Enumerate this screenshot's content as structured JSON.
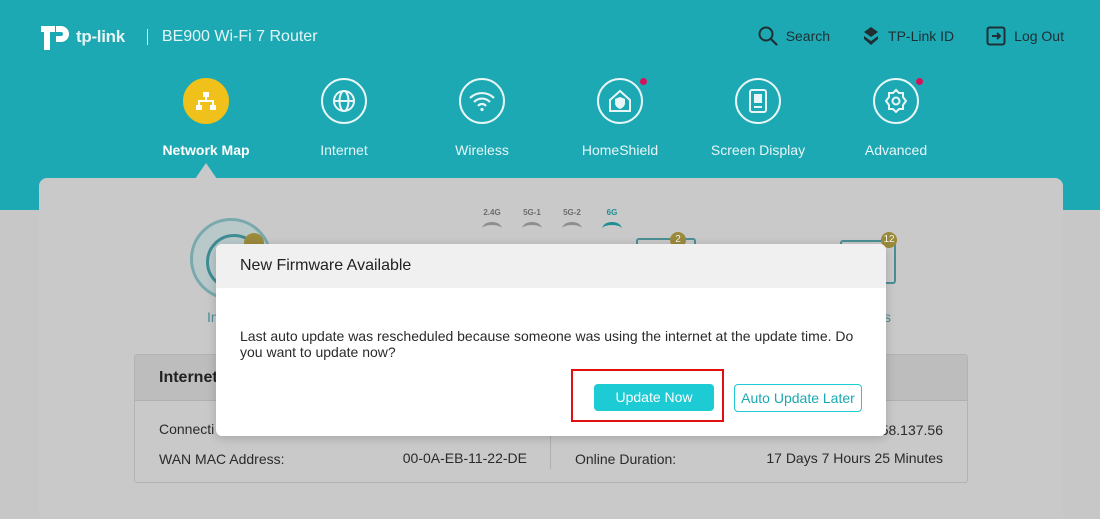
{
  "header": {
    "brand": "tp-link",
    "model": "BE900 Wi-Fi 7 Router",
    "links": {
      "search": "Search",
      "tplink_id": "TP-Link ID",
      "logout": "Log Out"
    }
  },
  "nav": {
    "items": [
      {
        "label": "Network Map",
        "icon": "network-map-icon",
        "active": true
      },
      {
        "label": "Internet",
        "icon": "globe-icon"
      },
      {
        "label": "Wireless",
        "icon": "wifi-icon"
      },
      {
        "label": "HomeShield",
        "icon": "home-shield-icon",
        "notify": true
      },
      {
        "label": "Screen Display",
        "icon": "screen-display-icon"
      },
      {
        "label": "Advanced",
        "icon": "gear-icon",
        "notify": true
      }
    ]
  },
  "background": {
    "bands": [
      "2.4G",
      "5G-1",
      "5G-2",
      "6G"
    ],
    "active_band": "6G",
    "badge_clients_a": "2",
    "badge_clients_b": "12",
    "internet_label_fragment": "In",
    "clients_label_fragment": "s",
    "internet_card": {
      "title": "Internet",
      "connection_label_fragment": "Connecti",
      "wan_mac_label": "WAN MAC Address:",
      "wan_mac_value": "00-0A-EB-11-22-DE",
      "ip_value_fragment": "58.137.56",
      "online_duration_label": "Online Duration:",
      "online_duration_value": "17 Days 7 Hours 25 Minutes"
    }
  },
  "dialog": {
    "title": "New Firmware Available",
    "message": "Last auto update was rescheduled because someone was using the internet at the update time. Do you want to update now?",
    "primary_button": "Update Now",
    "secondary_button": "Auto Update Later"
  },
  "colors": {
    "brand": "#1ca9b4",
    "accent_button": "#1ccbd4",
    "active_nav": "#f0c11a",
    "notification": "#d4145a",
    "highlight": "#e01010"
  }
}
